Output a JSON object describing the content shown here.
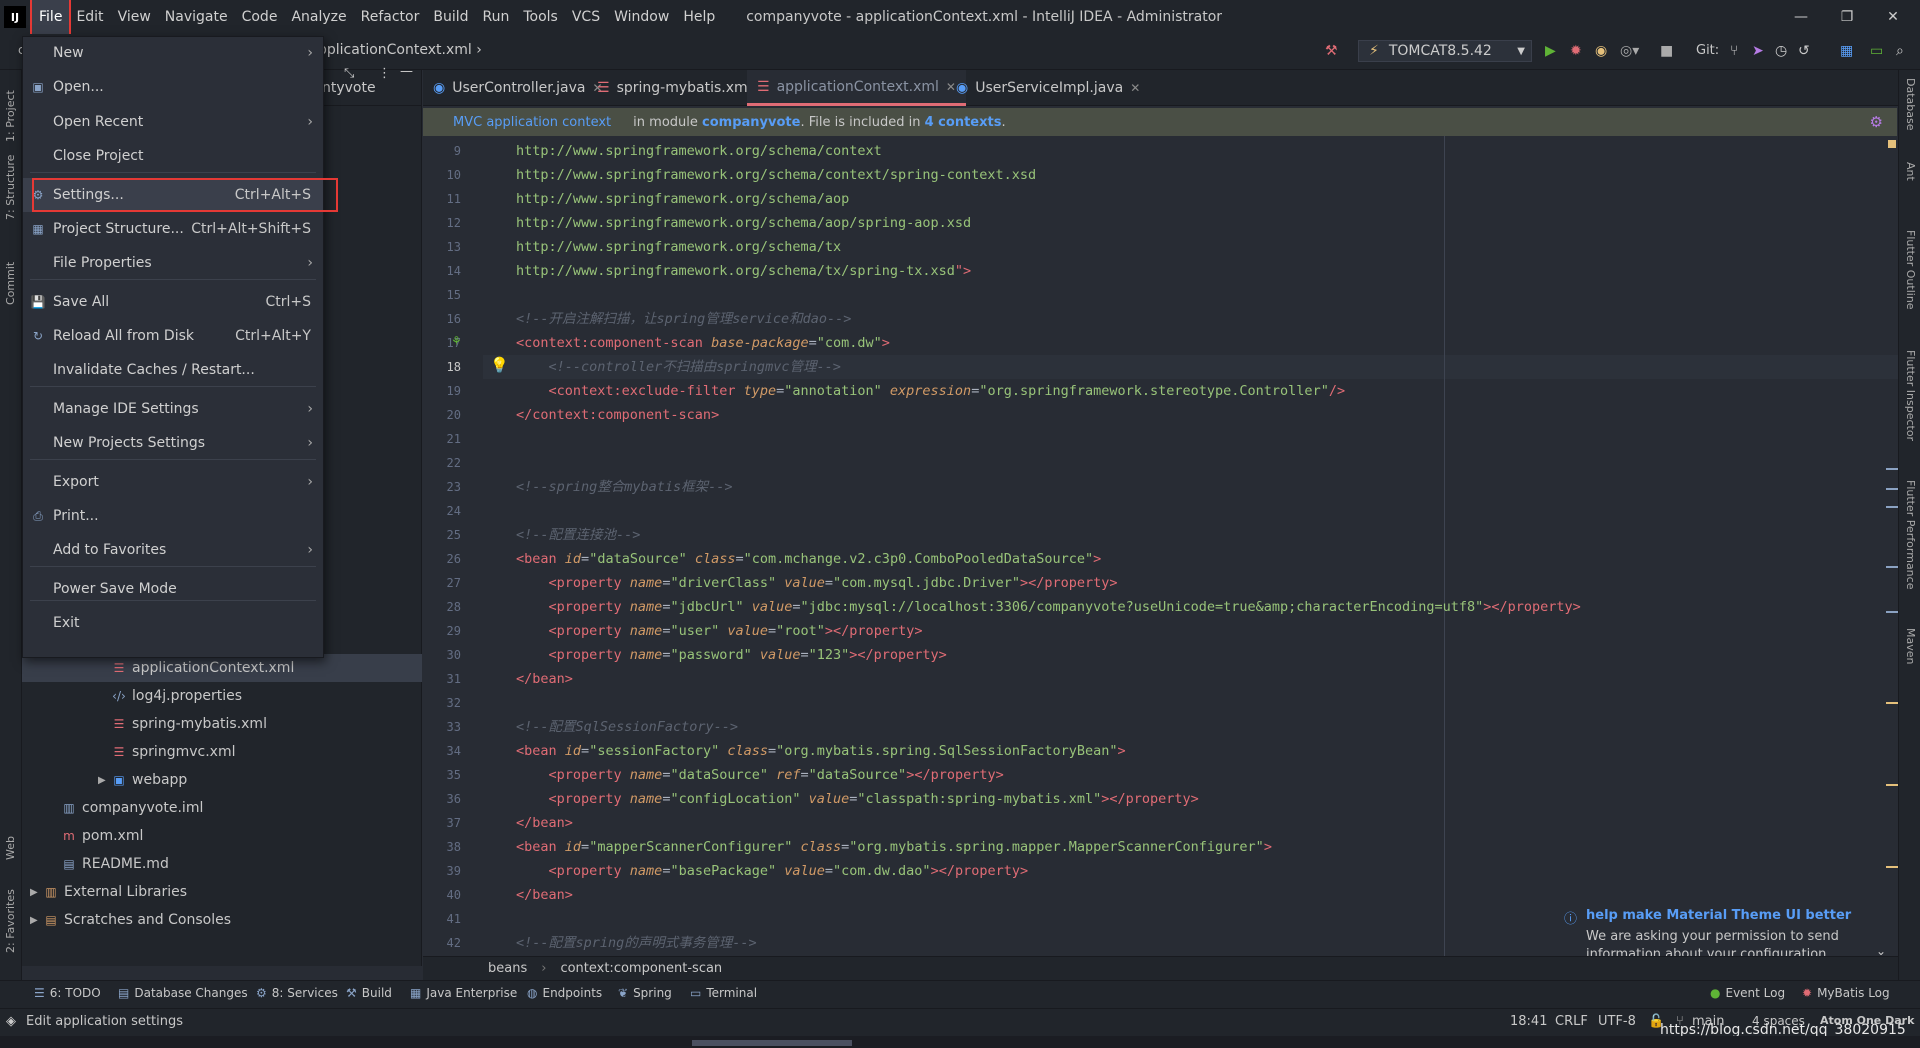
{
  "window": {
    "title": "companyvote - applicationContext.xml - IntelliJ IDEA - Administrator",
    "logo": "IJ",
    "controls": [
      "—",
      "❐",
      "✕"
    ]
  },
  "menubar": [
    "File",
    "Edit",
    "View",
    "Navigate",
    "Code",
    "Analyze",
    "Refactor",
    "Build",
    "Run",
    "Tools",
    "VCS",
    "Window",
    "Help"
  ],
  "navbar": {
    "project_abbrev": "cc",
    "breadcrumb": "pplicationContext.xml",
    "run_config": "TOMCAT8.5.42",
    "git_label": "Git:"
  },
  "file_menu": {
    "items": [
      {
        "label": "New",
        "shortcut": "",
        "submenu": true,
        "icon": ""
      },
      {
        "label": "Open...",
        "shortcut": "",
        "submenu": false,
        "icon": "folder-icon"
      },
      {
        "label": "Open Recent",
        "shortcut": "",
        "submenu": true,
        "icon": ""
      },
      {
        "label": "Close Project",
        "shortcut": "",
        "submenu": false,
        "icon": ""
      },
      {
        "label": "Settings...",
        "shortcut": "Ctrl+Alt+S",
        "submenu": false,
        "icon": "gear-icon"
      },
      {
        "label": "Project Structure...",
        "shortcut": "Ctrl+Alt+Shift+S",
        "submenu": false,
        "icon": "structure-icon"
      },
      {
        "label": "File Properties",
        "shortcut": "",
        "submenu": true,
        "icon": ""
      },
      {
        "label": "Save All",
        "shortcut": "Ctrl+S",
        "submenu": false,
        "icon": "save-icon"
      },
      {
        "label": "Reload All from Disk",
        "shortcut": "Ctrl+Alt+Y",
        "submenu": false,
        "icon": "reload-icon"
      },
      {
        "label": "Invalidate Caches / Restart...",
        "shortcut": "",
        "submenu": false,
        "icon": ""
      },
      {
        "label": "Manage IDE Settings",
        "shortcut": "",
        "submenu": true,
        "icon": ""
      },
      {
        "label": "New Projects Settings",
        "shortcut": "",
        "submenu": true,
        "icon": ""
      },
      {
        "label": "Export",
        "shortcut": "",
        "submenu": true,
        "icon": ""
      },
      {
        "label": "Print...",
        "shortcut": "",
        "submenu": false,
        "icon": "print-icon"
      },
      {
        "label": "Add to Favorites",
        "shortcut": "",
        "submenu": true,
        "icon": ""
      },
      {
        "label": "Power Save Mode",
        "shortcut": "",
        "submenu": false,
        "icon": ""
      },
      {
        "label": "Exit",
        "shortcut": "",
        "submenu": false,
        "icon": ""
      }
    ]
  },
  "project_tree": {
    "header_partial": "ntyvote",
    "rows": [
      {
        "label": "applicationContext.xml",
        "icon": "xml-icon",
        "selected": true
      },
      {
        "label": "log4j.properties",
        "icon": "properties-icon",
        "selected": false
      },
      {
        "label": "spring-mybatis.xml",
        "icon": "xml-icon",
        "selected": false
      },
      {
        "label": "springmvc.xml",
        "icon": "xml-icon",
        "selected": false
      },
      {
        "label": "webapp",
        "icon": "folder-icon",
        "selected": false
      },
      {
        "label": "companyvote.iml",
        "icon": "iml-icon",
        "selected": false
      },
      {
        "label": "pom.xml",
        "icon": "maven-icon",
        "selected": false
      },
      {
        "label": "README.md",
        "icon": "markdown-icon",
        "selected": false
      },
      {
        "label": "External Libraries",
        "icon": "library-icon",
        "selected": false
      },
      {
        "label": "Scratches and Consoles",
        "icon": "scratch-icon",
        "selected": false
      }
    ]
  },
  "tabs": [
    {
      "label": "UserController.java",
      "icon": "java-class-icon",
      "active": false
    },
    {
      "label": "spring-mybatis.xml",
      "icon": "xml-icon",
      "active": false
    },
    {
      "label": "applicationContext.xml",
      "icon": "xml-icon",
      "active": true
    },
    {
      "label": "UserServiceImpl.java",
      "icon": "java-class-icon",
      "active": false
    }
  ],
  "banner": {
    "context_link": "MVC application context",
    "text1": "in module",
    "module": "companyvote",
    "text2": ". File is included in",
    "contexts": "4 contexts",
    "text3": "."
  },
  "editor": {
    "line_numbers": [
      "9",
      "10",
      "11",
      "12",
      "13",
      "14",
      "15",
      "16",
      "17",
      "18",
      "19",
      "20",
      "21",
      "22",
      "23",
      "24",
      "25",
      "26",
      "27",
      "28",
      "29",
      "30",
      "31",
      "32",
      "33",
      "34",
      "35",
      "36",
      "37",
      "38",
      "39",
      "40",
      "41",
      "42"
    ],
    "lines": [
      [
        {
          "c": "url",
          "t": "http://www.springframework.org/schema/context"
        }
      ],
      [
        {
          "c": "url",
          "t": "http://www.springframework.org/schema/context/spring-context.xsd"
        }
      ],
      [
        {
          "c": "url",
          "t": "http://www.springframework.org/schema/aop"
        }
      ],
      [
        {
          "c": "url",
          "t": "http://www.springframework.org/schema/aop/spring-aop.xsd"
        }
      ],
      [
        {
          "c": "url",
          "t": "http://www.springframework.org/schema/tx"
        }
      ],
      [
        {
          "c": "url",
          "t": "http://www.springframework.org/schema/tx/spring-tx.xsd"
        },
        {
          "c": "tag",
          "t": "\">"
        }
      ],
      [],
      [
        {
          "c": "cmt",
          "t": "<!--开启注解扫描，让spring管理service和dao-->"
        }
      ],
      [
        {
          "c": "tag",
          "t": "<context:component-scan "
        },
        {
          "c": "attr",
          "t": "base-package"
        },
        {
          "c": "plain",
          "t": "="
        },
        {
          "c": "val",
          "t": "\"com.dw\""
        },
        {
          "c": "tag",
          "t": ">"
        }
      ],
      [
        {
          "c": "cmt",
          "t": "    <!--controller不扫描由springmvc管理-->"
        }
      ],
      [
        {
          "c": "tag",
          "t": "    <context:exclude-filter "
        },
        {
          "c": "attr",
          "t": "type"
        },
        {
          "c": "plain",
          "t": "="
        },
        {
          "c": "val",
          "t": "\"annotation\" "
        },
        {
          "c": "attr",
          "t": "expression"
        },
        {
          "c": "plain",
          "t": "="
        },
        {
          "c": "val",
          "t": "\"org.springframework.stereotype.Controller\""
        },
        {
          "c": "tag",
          "t": "/>"
        }
      ],
      [
        {
          "c": "tag",
          "t": "</context:component-scan>"
        }
      ],
      [],
      [],
      [
        {
          "c": "cmt",
          "t": "<!--spring整合mybatis框架-->"
        }
      ],
      [],
      [
        {
          "c": "cmt",
          "t": "<!--配置连接池-->"
        }
      ],
      [
        {
          "c": "tag",
          "t": "<bean "
        },
        {
          "c": "attr",
          "t": "id"
        },
        {
          "c": "plain",
          "t": "="
        },
        {
          "c": "val",
          "t": "\"dataSource\" "
        },
        {
          "c": "attr",
          "t": "class"
        },
        {
          "c": "plain",
          "t": "="
        },
        {
          "c": "val",
          "t": "\"com.mchange.v2.c3p0.ComboPooledDataSource\""
        },
        {
          "c": "tag",
          "t": ">"
        }
      ],
      [
        {
          "c": "tag",
          "t": "    <property "
        },
        {
          "c": "attr",
          "t": "name"
        },
        {
          "c": "plain",
          "t": "="
        },
        {
          "c": "val",
          "t": "\"driverClass\" "
        },
        {
          "c": "attr",
          "t": "value"
        },
        {
          "c": "plain",
          "t": "="
        },
        {
          "c": "val",
          "t": "\"com.mysql.jdbc.Driver\""
        },
        {
          "c": "tag",
          "t": "></property>"
        }
      ],
      [
        {
          "c": "tag",
          "t": "    <property "
        },
        {
          "c": "attr",
          "t": "name"
        },
        {
          "c": "plain",
          "t": "="
        },
        {
          "c": "val",
          "t": "\"jdbcUrl\" "
        },
        {
          "c": "attr",
          "t": "value"
        },
        {
          "c": "plain",
          "t": "="
        },
        {
          "c": "val",
          "t": "\"jdbc:mysql://localhost:3306/companyvote?useUnicode=true&amp;characterEncoding=utf8\""
        },
        {
          "c": "tag",
          "t": "></property>"
        }
      ],
      [
        {
          "c": "tag",
          "t": "    <property "
        },
        {
          "c": "attr",
          "t": "name"
        },
        {
          "c": "plain",
          "t": "="
        },
        {
          "c": "val",
          "t": "\"user\" "
        },
        {
          "c": "attr",
          "t": "value"
        },
        {
          "c": "plain",
          "t": "="
        },
        {
          "c": "val",
          "t": "\"root\""
        },
        {
          "c": "tag",
          "t": "></property>"
        }
      ],
      [
        {
          "c": "tag",
          "t": "    <property "
        },
        {
          "c": "attr",
          "t": "name"
        },
        {
          "c": "plain",
          "t": "="
        },
        {
          "c": "val",
          "t": "\"password\" "
        },
        {
          "c": "attr",
          "t": "value"
        },
        {
          "c": "plain",
          "t": "="
        },
        {
          "c": "val",
          "t": "\"123\""
        },
        {
          "c": "tag",
          "t": "></property>"
        }
      ],
      [
        {
          "c": "tag",
          "t": "</bean>"
        }
      ],
      [],
      [
        {
          "c": "cmt",
          "t": "<!--配置SqlSessionFactory-->"
        }
      ],
      [
        {
          "c": "tag",
          "t": "<bean "
        },
        {
          "c": "attr",
          "t": "id"
        },
        {
          "c": "plain",
          "t": "="
        },
        {
          "c": "val",
          "t": "\"sessionFactory\" "
        },
        {
          "c": "attr",
          "t": "class"
        },
        {
          "c": "plain",
          "t": "="
        },
        {
          "c": "val",
          "t": "\"org.mybatis.spring.SqlSessionFactoryBean\""
        },
        {
          "c": "tag",
          "t": ">"
        }
      ],
      [
        {
          "c": "tag",
          "t": "    <property "
        },
        {
          "c": "attr",
          "t": "name"
        },
        {
          "c": "plain",
          "t": "="
        },
        {
          "c": "val",
          "t": "\"dataSource\" "
        },
        {
          "c": "attr",
          "t": "ref"
        },
        {
          "c": "plain",
          "t": "="
        },
        {
          "c": "val",
          "t": "\"dataSource\""
        },
        {
          "c": "tag",
          "t": "></property>"
        }
      ],
      [
        {
          "c": "tag",
          "t": "    <property "
        },
        {
          "c": "attr",
          "t": "name"
        },
        {
          "c": "plain",
          "t": "="
        },
        {
          "c": "val",
          "t": "\"configLocation\" "
        },
        {
          "c": "attr",
          "t": "value"
        },
        {
          "c": "plain",
          "t": "="
        },
        {
          "c": "val",
          "t": "\"classpath:spring-mybatis.xml\""
        },
        {
          "c": "tag",
          "t": "></property>"
        }
      ],
      [
        {
          "c": "tag",
          "t": "</bean>"
        }
      ],
      [
        {
          "c": "tag",
          "t": "<bean "
        },
        {
          "c": "attr",
          "t": "id"
        },
        {
          "c": "plain",
          "t": "="
        },
        {
          "c": "val",
          "t": "\"mapperScannerConfigurer\" "
        },
        {
          "c": "attr",
          "t": "class"
        },
        {
          "c": "plain",
          "t": "="
        },
        {
          "c": "val",
          "t": "\"org.mybatis.spring.mapper.MapperScannerConfigurer\""
        },
        {
          "c": "tag",
          "t": ">"
        }
      ],
      [
        {
          "c": "tag",
          "t": "    <property "
        },
        {
          "c": "attr",
          "t": "name"
        },
        {
          "c": "plain",
          "t": "="
        },
        {
          "c": "val",
          "t": "\"basePackage\" "
        },
        {
          "c": "attr",
          "t": "value"
        },
        {
          "c": "plain",
          "t": "="
        },
        {
          "c": "val",
          "t": "\"com.dw.dao\""
        },
        {
          "c": "tag",
          "t": "></property>"
        }
      ],
      [
        {
          "c": "tag",
          "t": "</bean>"
        }
      ],
      [],
      [
        {
          "c": "cmt",
          "t": "<!--配置spring的声明式事务管理-->"
        }
      ]
    ]
  },
  "editor_breadcrumb": [
    "beans",
    "context:component-scan"
  ],
  "notification": {
    "title": "help make Material Theme UI better",
    "body1": "We are asking your permission to send",
    "body2": "information about your configuration..."
  },
  "left_strip": [
    "1: Project",
    "7: Structure",
    "Commit",
    "Web",
    "2: Favorites"
  ],
  "right_strip": [
    "Database",
    "Ant",
    "Flutter Outline",
    "Flutter Inspector",
    "Flutter Performance",
    "Maven"
  ],
  "toolwindows": [
    {
      "label": "6: TODO",
      "icon": "todo-icon"
    },
    {
      "label": "Database Changes",
      "icon": "database-icon"
    },
    {
      "label": "8: Services",
      "icon": "services-icon"
    },
    {
      "label": "Build",
      "icon": "build-icon"
    },
    {
      "label": "Java Enterprise",
      "icon": "java-ee-icon"
    },
    {
      "label": "Endpoints",
      "icon": "endpoints-icon"
    },
    {
      "label": "Spring",
      "icon": "spring-icon"
    },
    {
      "label": "Terminal",
      "icon": "terminal-icon"
    },
    {
      "label": "Event Log",
      "icon": "event-log-icon"
    },
    {
      "label": "MyBatis Log",
      "icon": "mybatis-icon"
    }
  ],
  "status": {
    "message": "Edit application settings",
    "position": "18:41",
    "line_sep": "CRLF",
    "encoding": "UTF-8",
    "branch": "main",
    "indent": "4 spaces",
    "theme": "Atom One Dark",
    "watermark": "https://blog.csdn.net/qq_38020915"
  },
  "colors": {
    "accent_red": "#e53935",
    "link_blue": "#589df6",
    "tag": "#e06c75",
    "string": "#98c379",
    "attr": "#d19a66",
    "comment": "#5c6370"
  }
}
